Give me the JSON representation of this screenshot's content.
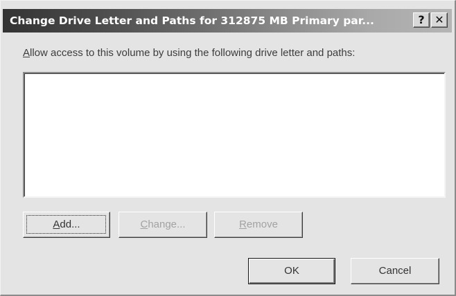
{
  "dialog": {
    "title": "Change Drive Letter and Paths for 312875 MB  Primary par...",
    "help_glyph": "?",
    "close_glyph": "✕",
    "description_mnemonic": "A",
    "description_rest": "llow access to this volume by using the following drive letter and paths:",
    "paths": []
  },
  "buttons": {
    "add": {
      "mnemonic": "A",
      "pre": "",
      "post": "dd...",
      "enabled": true,
      "focused": true
    },
    "change": {
      "mnemonic": "C",
      "pre": "",
      "post": "hange...",
      "enabled": false
    },
    "remove": {
      "mnemonic": "R",
      "pre": "",
      "post": "emove",
      "enabled": false
    },
    "ok": {
      "label": "OK",
      "enabled": true
    },
    "cancel": {
      "label": "Cancel",
      "enabled": true
    }
  },
  "colors": {
    "dialog_face": "#e4e4e4",
    "title_gradient_start": "#333333",
    "title_gradient_end": "#b5b5b5",
    "disabled_text": "#a2a2a2"
  }
}
